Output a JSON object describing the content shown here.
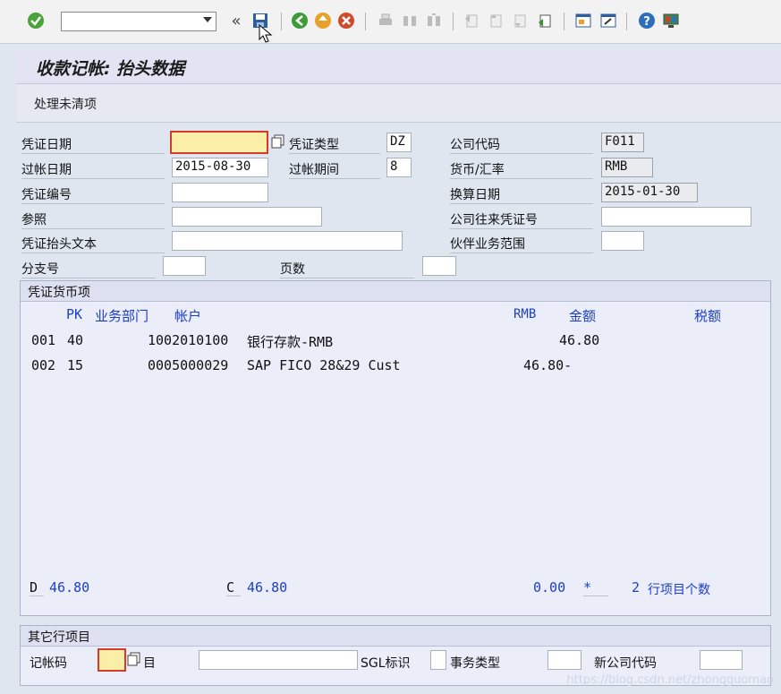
{
  "toolbar": {
    "command_value": "",
    "icons": [
      "check-icon",
      "back-icon",
      "save-icon",
      "back-green-icon",
      "exit-icon",
      "cancel-icon",
      "print-icon",
      "find-icon",
      "find-next-icon",
      "first-page-icon",
      "prev-page-icon",
      "next-page-icon",
      "last-page-icon",
      "new-session-icon",
      "shortcut-icon",
      "help-icon",
      "layout-icon"
    ]
  },
  "header": {
    "title": "收款记帐: 抬头数据"
  },
  "appbar": {
    "open_items_label": "处理未清项"
  },
  "form": {
    "doc_date_label": "凭证日期",
    "doc_date_value": "",
    "doc_type_label": "凭证类型",
    "doc_type_value": "DZ",
    "company_code_label": "公司代码",
    "company_code_value": "F011",
    "posting_date_label": "过帐日期",
    "posting_date_value": "2015-08-30",
    "period_label": "过帐期间",
    "period_value": "8",
    "currency_label": "货币/汇率",
    "currency_value": "RMB",
    "doc_number_label": "凭证编号",
    "doc_number_value": "",
    "translation_date_label": "换算日期",
    "translation_date_value": "2015-01-30",
    "reference_label": "参照",
    "reference_value": "",
    "intercompany_label": "公司往来凭证号",
    "intercompany_value": "",
    "header_text_label": "凭证抬头文本",
    "header_text_value": "",
    "partner_ba_label": "伙伴业务范围",
    "partner_ba_value": "",
    "branch_label": "分支号",
    "branch_value": "",
    "pages_label": "页数",
    "pages_value": ""
  },
  "items": {
    "group_title": "凭证货币项",
    "col_pk": "PK",
    "col_ba": "业务部门",
    "col_account": "帐户",
    "col_currency": "RMB",
    "col_amount": "金额",
    "col_tax": "税额",
    "rows": [
      {
        "no": "001",
        "pk": "40",
        "account": "1002010100",
        "desc": "银行存款-RMB",
        "amount": "46.80"
      },
      {
        "no": "002",
        "pk": "15",
        "account": "0005000029",
        "desc": "SAP FICO 28&29 Cust",
        "amount": "46.80-"
      }
    ],
    "debit_label": "D",
    "debit_value": "46.80",
    "credit_label": "C",
    "credit_value": "46.80",
    "balance_value": "0.00",
    "balance_flag": "*",
    "count_value": "2",
    "count_label": "行项目个数"
  },
  "other": {
    "group_title": "其它行项目",
    "posting_key_label": "记帐码",
    "posting_key_value": "",
    "account_label": "目",
    "account_value": "",
    "sgl_label": "SGL标识",
    "sgl_value": "",
    "trans_type_label": "事务类型",
    "trans_type_value": "",
    "new_cc_label": "新公司代码",
    "new_cc_value": ""
  },
  "watermark": "https://blog.csdn.net/zhongguomao"
}
